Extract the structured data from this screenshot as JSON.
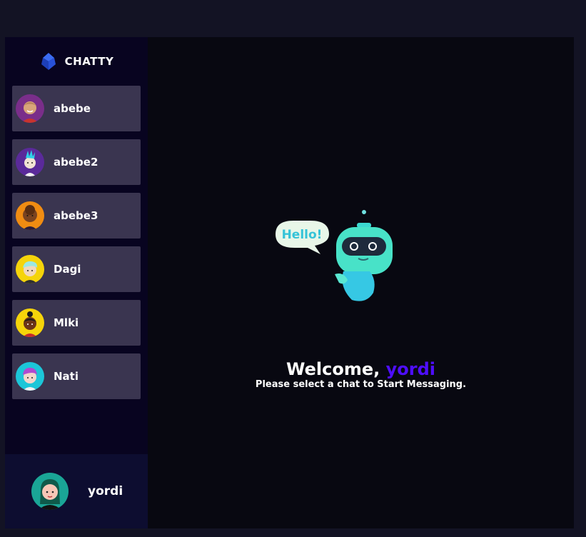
{
  "app": {
    "title": "CHATTY"
  },
  "contacts": [
    {
      "name": "abebe",
      "avatar_color": "#7a2e8a"
    },
    {
      "name": "abebe2",
      "avatar_color": "#5a2a9a"
    },
    {
      "name": "abebe3",
      "avatar_color": "#f08c12"
    },
    {
      "name": "Dagi",
      "avatar_color": "#f5d40a"
    },
    {
      "name": "Mlki",
      "avatar_color": "#f5d40a"
    },
    {
      "name": "Nati",
      "avatar_color": "#1cc6d8"
    }
  ],
  "current_user": {
    "name": "yordi",
    "avatar_color": "#1aa596"
  },
  "welcome": {
    "greeting": "Welcome,",
    "username": "yordi",
    "subtitle": "Please select a chat to Start Messaging."
  },
  "robot_bubble_text": "Hello!",
  "colors": {
    "accent": "#4e0eff",
    "sidebar": "#080420",
    "contact_bg": "#3a3550",
    "main_bg": "#080811",
    "page_bg": "#131324"
  }
}
